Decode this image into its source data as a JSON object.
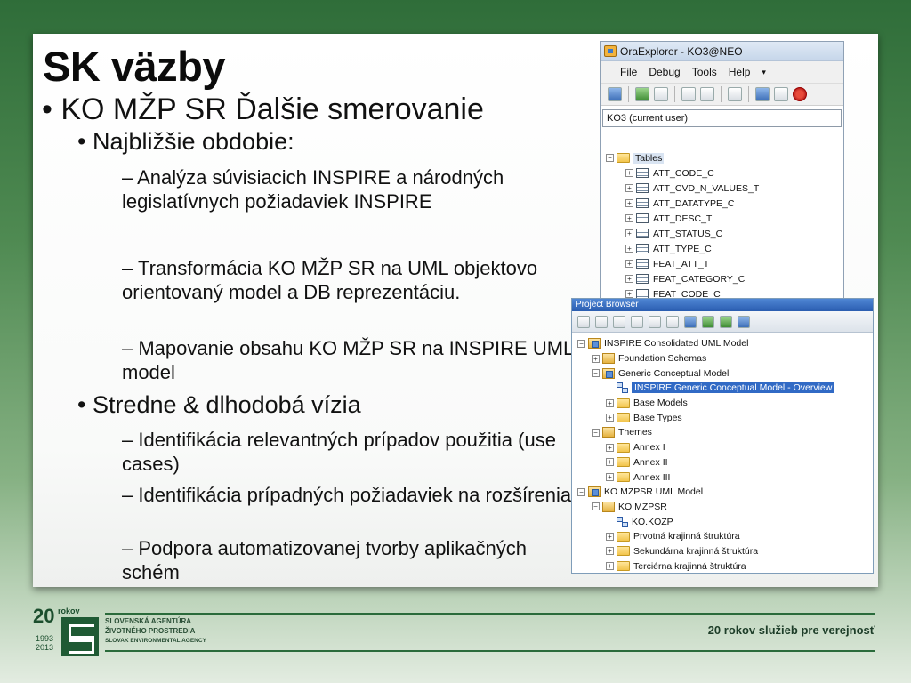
{
  "slide": {
    "title": "SK väzby",
    "level1": "KO MŽP SR Ďalšie smerovanie",
    "section1": "Najbližšie obdobie:",
    "section1_items": [
      "– Analýza súvisiacich INSPIRE a národných legislatívnych požiadaviek INSPIRE",
      "– Transformácia KO MŽP SR na UML objektovo orientovaný model a DB reprezentáciu.",
      "– Mapovanie obsahu KO MŽP SR na INSPIRE UML model"
    ],
    "section2": "Stredne & dlhodobá vízia",
    "section2_items": [
      "– Identifikácia relevantných prípadov použitia (use cases)",
      "– Identifikácia prípadných požiadaviek na rozšírenia",
      "– Podpora automatizovanej tvorby aplikačných schém"
    ]
  },
  "oraexplorer": {
    "title": "OraExplorer - KO3@NEO",
    "menu": [
      "File",
      "Debug",
      "Tools",
      "Help"
    ],
    "schema": "KO3 (current user)",
    "root": "Tables",
    "tables": [
      "ATT_CODE_C",
      "ATT_CVD_N_VALUES_T",
      "ATT_DATATYPE_C",
      "ATT_DESC_T",
      "ATT_STATUS_C",
      "ATT_TYPE_C",
      "FEAT_ATT_T",
      "FEAT_CATEGORY_C",
      "FEAT_CODE_C"
    ]
  },
  "project_browser": {
    "title": "Project Browser",
    "nodes": [
      {
        "label": "INSPIRE Consolidated UML Model"
      },
      {
        "label": "Foundation Schemas"
      },
      {
        "label": "Generic Conceptual Model"
      },
      {
        "label": "INSPIRE Generic Conceptual Model - Overview"
      },
      {
        "label": "Base Models"
      },
      {
        "label": "Base Types"
      },
      {
        "label": "Themes"
      },
      {
        "label": "Annex I"
      },
      {
        "label": "Annex II"
      },
      {
        "label": "Annex III"
      },
      {
        "label": "KO MZPSR UML Model"
      },
      {
        "label": "KO MZPSR"
      },
      {
        "label": "KO.KOZP"
      },
      {
        "label": "Prvotná krajinná štruktúra"
      },
      {
        "label": "Sekundárna krajinná štruktúra"
      },
      {
        "label": "Terciérna krajinná štruktúra"
      }
    ]
  },
  "footer": {
    "logo_number": "20",
    "logo_rokov": "rokov",
    "logo_years": [
      "1993",
      "2013"
    ],
    "agency": [
      "SLOVENSKÁ AGENTÚRA",
      "ŽIVOTNÉHO PROSTREDIA",
      "SLOVAK ENVIRONMENTAL AGENCY"
    ],
    "slogan": "20 rokov služieb pre verejnosť"
  }
}
